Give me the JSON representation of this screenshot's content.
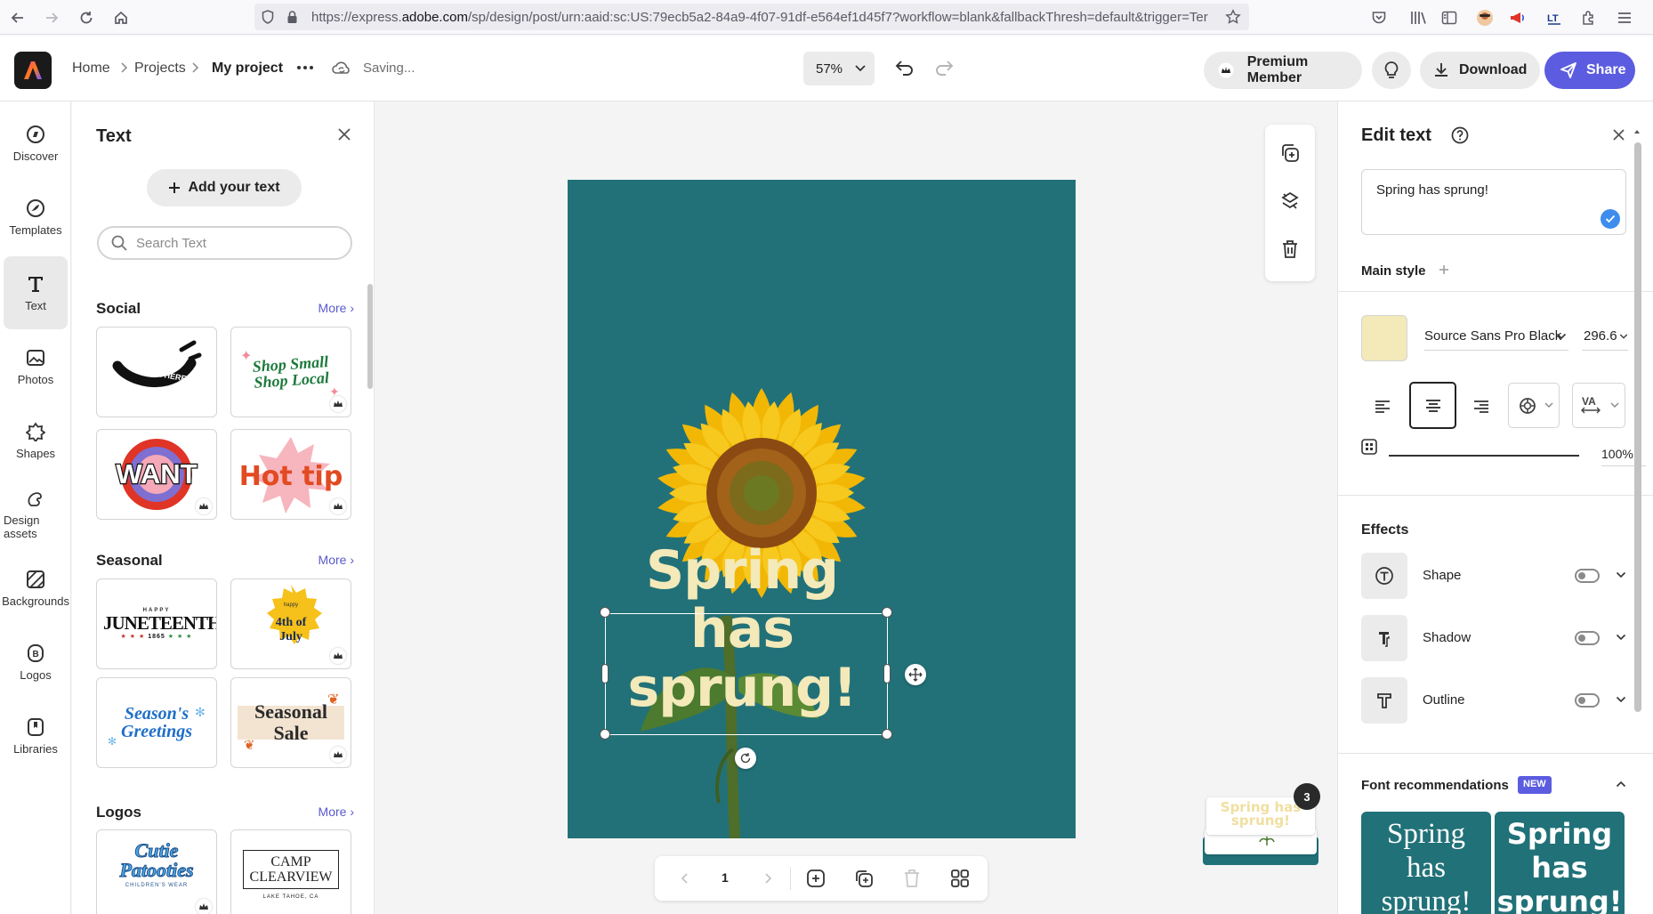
{
  "browser": {
    "url_prefix": "https://express.",
    "url_host": "adobe.com",
    "url_rest": "/sp/design/post/urn:aaid:sc:US:79ecb5a2-84a9-4f07-91df-e564ef1d45f7?workflow=blank&fallbackThresh=default&trigger=Ter"
  },
  "header": {
    "breadcrumb": [
      "Home",
      "Projects",
      "My project"
    ],
    "save_status": "Saving...",
    "zoom": "57%",
    "premium_label": "Premium Member",
    "download_label": "Download",
    "share_label": "Share"
  },
  "rail": {
    "items": [
      {
        "label": "Discover",
        "icon": "compass-icon"
      },
      {
        "label": "Templates",
        "icon": "templates-icon"
      },
      {
        "label": "Text",
        "icon": "text-icon"
      },
      {
        "label": "Photos",
        "icon": "photos-icon"
      },
      {
        "label": "Shapes",
        "icon": "shapes-icon"
      },
      {
        "label": "Design assets",
        "icon": "design-assets-icon"
      },
      {
        "label": "Backgrounds",
        "icon": "backgrounds-icon"
      },
      {
        "label": "Logos",
        "icon": "logos-icon"
      },
      {
        "label": "Libraries",
        "icon": "libraries-icon"
      }
    ]
  },
  "text_panel": {
    "title": "Text",
    "add_button": "Add your text",
    "search_placeholder": "Search Text",
    "more_label": "More",
    "sections": [
      {
        "title": "Social",
        "tiles": [
          "ORDER HERE",
          "Shop Small Shop Local",
          "WANT",
          "Hot tip"
        ]
      },
      {
        "title": "Seasonal",
        "tiles": [
          "JUNETEENTH",
          "4th of July",
          "Season's Greetings",
          "Seasonal Sale"
        ]
      },
      {
        "title": "Logos",
        "tiles": [
          "Cutie Patooties",
          "CAMP CLEARVIEW"
        ]
      }
    ],
    "tile_small": {
      "happy": "HAPPY",
      "year": "1865",
      "happy_lc": "happy",
      "children": "CHILDREN'S WEAR",
      "lake": "LAKE TAHOE, CA"
    }
  },
  "canvas": {
    "text_line1": "Spring has",
    "text_line2": "sprung!",
    "page_number": "1",
    "pages_badge": "3",
    "thumb_text": "Spring has sprung!"
  },
  "edit_panel": {
    "title": "Edit text",
    "text_value": "Spring has sprung!",
    "main_style": "Main style",
    "font_name": "Source Sans Pro Black",
    "font_size": "296.6",
    "opacity": "100",
    "opacity_unit": "%",
    "opacity_value": 1.0,
    "text_color": "#f3e9b9",
    "effects_title": "Effects",
    "effects": [
      "Shape",
      "Shadow",
      "Outline"
    ],
    "font_rec_title": "Font recommendations",
    "new_badge": "NEW",
    "rec_text": [
      "Spring",
      "has",
      "sprung!"
    ]
  },
  "colors": {
    "accent": "#5c5ce0",
    "artboard": "#227178",
    "text_fill": "#f3e9b9"
  }
}
